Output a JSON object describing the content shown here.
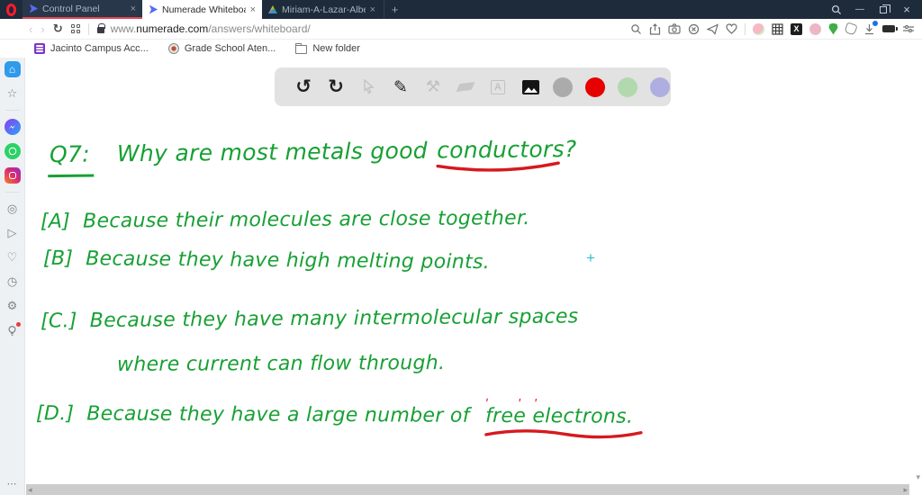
{
  "tab_bar": {
    "tabs": [
      {
        "label": "Control Panel"
      },
      {
        "label": "Numerade Whiteboard"
      },
      {
        "label": "Miriam-A-Lazar-Albert-Ta"
      }
    ],
    "close_glyph": "×",
    "new_tab_glyph": "+"
  },
  "window_controls": {
    "minimize": "—",
    "close": "×"
  },
  "address_bar": {
    "back_glyph": "‹",
    "forward_glyph": "›",
    "reload_glyph": "↻",
    "url_prefix": "www.",
    "url_domain": "numerade.com",
    "url_path": "/answers/whiteboard/"
  },
  "bookmarks_bar": {
    "items": [
      {
        "label": "Jacinto Campus Acc..."
      },
      {
        "label": "Grade School Aten..."
      },
      {
        "label": "New folder"
      }
    ]
  },
  "sidebar": {
    "glyphs": {
      "home": "⌂",
      "star": "☆",
      "plane": "▷",
      "heart": "♡",
      "clock": "◷",
      "gear": "⚙",
      "player": "◎",
      "bulb": "○",
      "dots": "⋯"
    }
  },
  "whiteboard": {
    "toolbar": {
      "undo_glyph": "↺",
      "redo_glyph": "↻",
      "pen_glyph": "✎",
      "tools_glyph": "⚒",
      "text_tool_label": "A",
      "swatches": [
        {
          "name": "gray",
          "color": "#ababab"
        },
        {
          "name": "red",
          "color": "#e60000"
        },
        {
          "name": "green",
          "color": "#b2d9ad"
        },
        {
          "name": "purple",
          "color": "#aeaee0"
        }
      ]
    },
    "ink_color": "#17a034",
    "accent_color": "#d6191f",
    "question": {
      "label": "Q7:",
      "text": "Why are most metals good",
      "highlight": "conductors?"
    },
    "options": [
      {
        "label": "[A]",
        "text": "Because their molecules are close together."
      },
      {
        "label": "[B]",
        "text": "Because they have high melting points."
      },
      {
        "label": "[C.]",
        "text": "Because they have many intermolecular spaces",
        "text_line2": "where current can flow through."
      },
      {
        "label": "[D.]",
        "text": "Because they have a large number of",
        "highlight": "free electrons."
      }
    ],
    "cursor_glyph": "+"
  }
}
